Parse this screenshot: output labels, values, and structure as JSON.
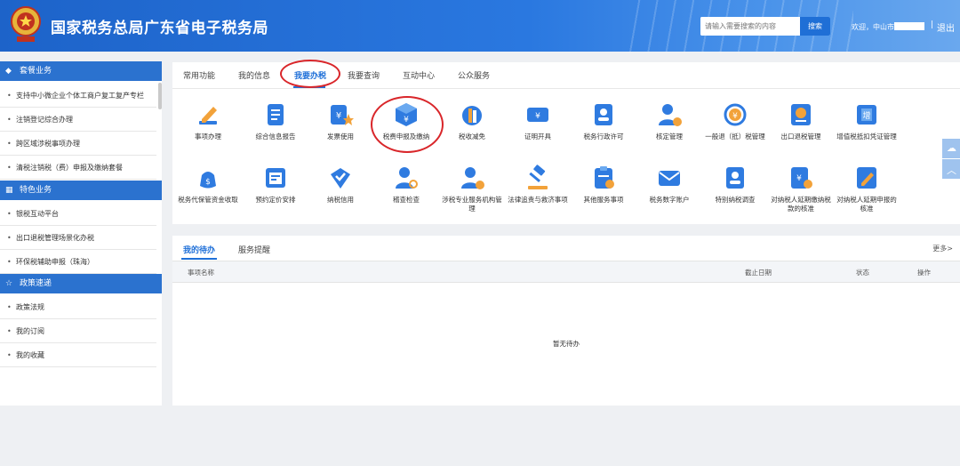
{
  "header": {
    "title": "国家税务总局广东省电子税务局",
    "search_placeholder": "请输入需要搜索的内容",
    "search_button": "搜索",
    "welcome": "欢迎，中山市",
    "separator": "|",
    "logout": "退出",
    "accent_color": "#1d63c9"
  },
  "sidebar": {
    "sections": [
      {
        "title": "套餐业务",
        "icon": "cube-icon",
        "items": [
          "支持中小微企业个体工商户复工复产专栏",
          "注销登记综合办理",
          "跨区域涉税事项办理",
          "清税注销税（费）申报及缴纳套餐"
        ]
      },
      {
        "title": "特色业务",
        "icon": "grid-icon",
        "items": [
          "银税互动平台",
          "出口退税管理场景化办税",
          "环保税辅助申报（珠海）"
        ]
      },
      {
        "title": "政策速递",
        "icon": "star-icon",
        "items": [
          "政策法规",
          "我的订阅",
          "我的收藏"
        ]
      }
    ]
  },
  "tabs": [
    "常用功能",
    "我的信息",
    "我要办税",
    "我要查询",
    "互动中心",
    "公众服务"
  ],
  "active_tab": "我要办税",
  "tiles": [
    {
      "label": "事项办理",
      "icon": "pen-icon"
    },
    {
      "label": "综合信息报告",
      "icon": "report-icon"
    },
    {
      "label": "发票使用",
      "icon": "invoice-icon"
    },
    {
      "label": "税费申报及缴纳",
      "icon": "tax-box-icon"
    },
    {
      "label": "税收减免",
      "icon": "coins-icon"
    },
    {
      "label": "证明开具",
      "icon": "ticket-icon"
    },
    {
      "label": "税务行政许可",
      "icon": "id-card-icon"
    },
    {
      "label": "核定管理",
      "icon": "user-gear-icon"
    },
    {
      "label": "一般退（抵）税管理",
      "icon": "refund-icon"
    },
    {
      "label": "出口退税管理",
      "icon": "export-icon"
    },
    {
      "label": "增值税抵扣凭证管理",
      "icon": "vat-icon"
    },
    {
      "label": "税务代保管资金收取",
      "icon": "money-bag-icon"
    },
    {
      "label": "预约定价安排",
      "icon": "calendar-icon"
    },
    {
      "label": "纳税信用",
      "icon": "diamond-icon"
    },
    {
      "label": "稽查检查",
      "icon": "inspect-icon"
    },
    {
      "label": "涉税专业服务机构管理",
      "icon": "agency-icon"
    },
    {
      "label": "法律追责与救济事项",
      "icon": "gavel-icon"
    },
    {
      "label": "其他服务事项",
      "icon": "clipboard-icon"
    },
    {
      "label": "税务数字账户",
      "icon": "mail-icon"
    },
    {
      "label": "特别纳税调查",
      "icon": "person-card-icon"
    },
    {
      "label": "对纳税人延期缴纳税款的核准",
      "icon": "delay-pay-icon"
    },
    {
      "label": "对纳税人延期申报的核准",
      "icon": "delay-edit-icon"
    }
  ],
  "todo": {
    "tabs": [
      "我的待办",
      "服务提醒"
    ],
    "more": "更多>",
    "columns": [
      "事项名称",
      "截止日期",
      "状态",
      "操作"
    ],
    "empty": "暂无待办"
  }
}
